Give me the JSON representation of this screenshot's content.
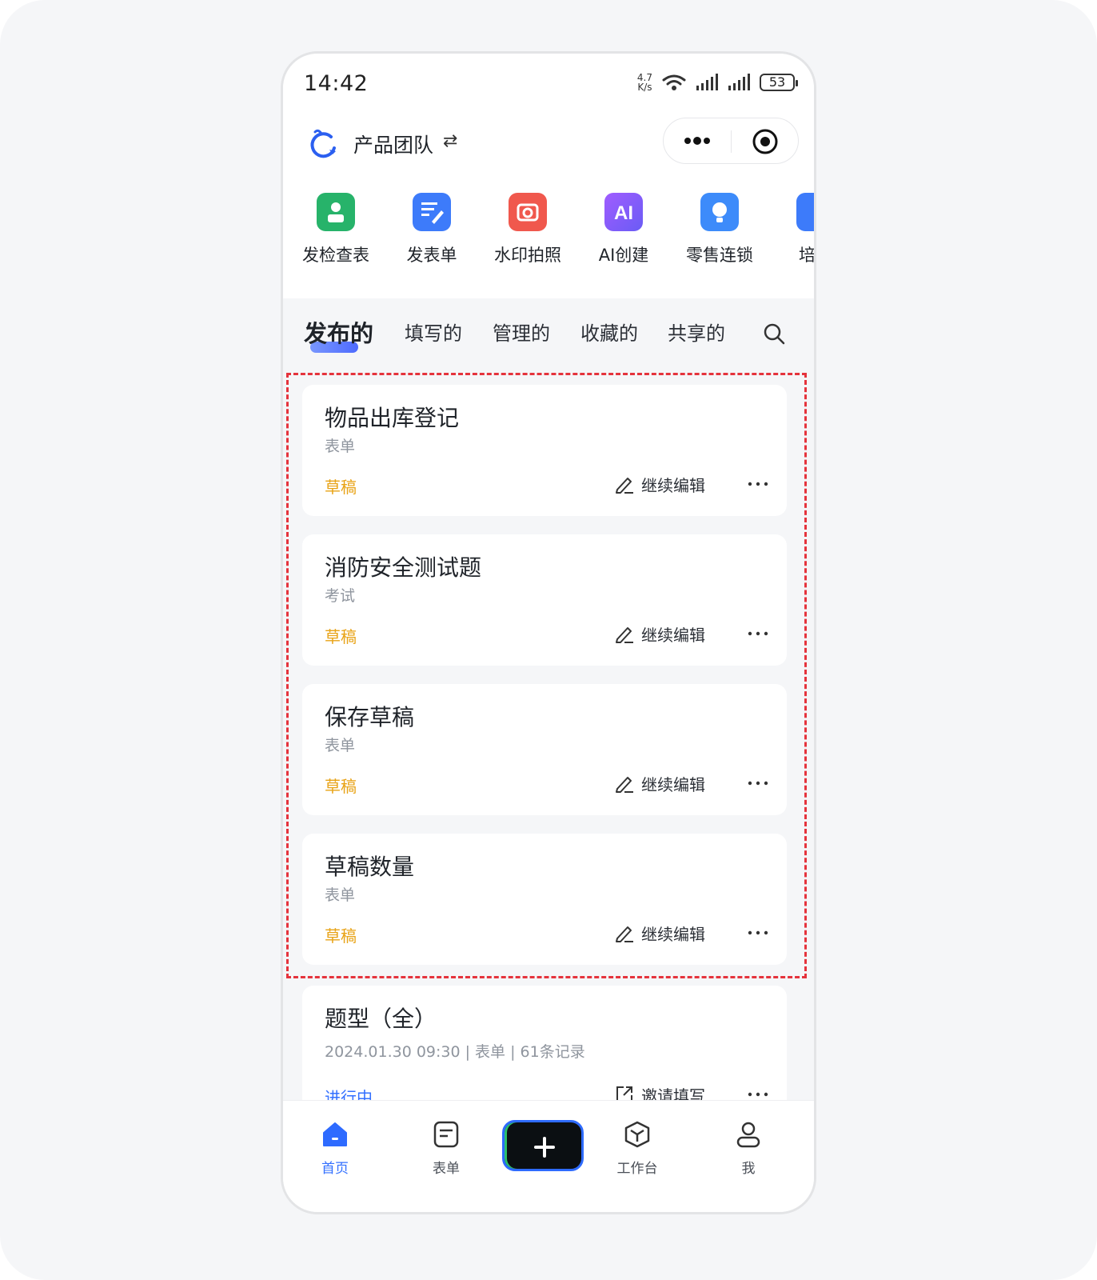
{
  "status_bar": {
    "time": "14:42",
    "net_speed_value": "4.7",
    "net_speed_unit": "K/s",
    "battery": "53"
  },
  "header": {
    "team_name": "产品团队",
    "swap_symbol": "⇄"
  },
  "shortcuts": [
    {
      "label": "发检查表",
      "icon": "checklist-icon",
      "color": "#27b36a"
    },
    {
      "label": "发表单",
      "icon": "form-edit-icon",
      "color": "#3d7bfa"
    },
    {
      "label": "水印拍照",
      "icon": "camera-icon",
      "color": "#f0584d"
    },
    {
      "label": "AI创建",
      "icon": "ai-icon",
      "color": "#8a55f5"
    },
    {
      "label": "零售连锁",
      "icon": "lightbulb-icon",
      "color": "#3d8bfa"
    },
    {
      "label": "培训",
      "icon": "training-icon",
      "color": "#3d7bfa"
    }
  ],
  "tabs": {
    "published": "发布的",
    "filled": "填写的",
    "managed": "管理的",
    "favorites": "收藏的",
    "shared": "共享的"
  },
  "cards": [
    {
      "title": "物品出库登记",
      "subtitle": "表单",
      "status": "草稿",
      "action": "继续编辑"
    },
    {
      "title": "消防安全测试题",
      "subtitle": "考试",
      "status": "草稿",
      "action": "继续编辑"
    },
    {
      "title": "保存草稿",
      "subtitle": "表单",
      "status": "草稿",
      "action": "继续编辑"
    },
    {
      "title": "草稿数量",
      "subtitle": "表单",
      "status": "草稿",
      "action": "继续编辑"
    },
    {
      "title": "题型（全）",
      "subtitle": "2024.01.30 09:30 | 表单 | 61条记录",
      "status": "进行中",
      "action": "邀请填写"
    }
  ],
  "bottom_nav": {
    "home": "首页",
    "forms": "表单",
    "workbench": "工作台",
    "me": "我"
  },
  "colors": {
    "accent": "#3370ff",
    "draft": "#e8a317",
    "highlight": "#e5333c"
  }
}
